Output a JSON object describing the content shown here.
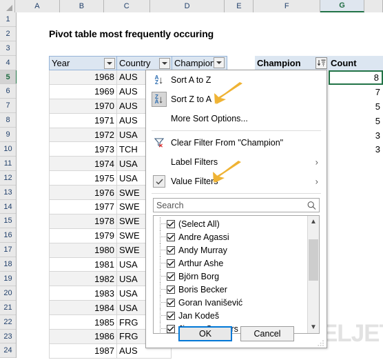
{
  "spreadsheet": {
    "columns": [
      "A",
      "B",
      "C",
      "D",
      "E",
      "F",
      "G"
    ],
    "selected_column": "G",
    "rows": [
      "1",
      "2",
      "3",
      "4",
      "5",
      "6",
      "7",
      "8",
      "9",
      "10",
      "11",
      "12",
      "13",
      "14",
      "15",
      "16",
      "17",
      "18",
      "19",
      "20",
      "21",
      "22",
      "23",
      "24"
    ],
    "selected_row": "5",
    "title": "Pivot table most frequently occuring"
  },
  "source_table": {
    "headers": [
      "Year",
      "Country",
      "Champion"
    ],
    "rows": [
      {
        "year": "1968",
        "country": "AUS"
      },
      {
        "year": "1969",
        "country": "AUS"
      },
      {
        "year": "1970",
        "country": "AUS"
      },
      {
        "year": "1971",
        "country": "AUS"
      },
      {
        "year": "1972",
        "country": "USA"
      },
      {
        "year": "1973",
        "country": "TCH"
      },
      {
        "year": "1974",
        "country": "USA"
      },
      {
        "year": "1975",
        "country": "USA"
      },
      {
        "year": "1976",
        "country": "SWE"
      },
      {
        "year": "1977",
        "country": "SWE"
      },
      {
        "year": "1978",
        "country": "SWE"
      },
      {
        "year": "1979",
        "country": "SWE"
      },
      {
        "year": "1980",
        "country": "SWE"
      },
      {
        "year": "1981",
        "country": "USA"
      },
      {
        "year": "1982",
        "country": "USA"
      },
      {
        "year": "1983",
        "country": "USA"
      },
      {
        "year": "1984",
        "country": "USA"
      },
      {
        "year": "1985",
        "country": "FRG"
      },
      {
        "year": "1986",
        "country": "FRG"
      },
      {
        "year": "1987",
        "country": "AUS"
      }
    ]
  },
  "pivot_table": {
    "headers": [
      "Champion",
      "Count"
    ],
    "counts": [
      "8",
      "7",
      "5",
      "5",
      "3",
      "3"
    ],
    "selected_cell_value": "8"
  },
  "dropdown": {
    "sort_a_to_z": "Sort A to Z",
    "sort_z_to_a": "Sort Z to A",
    "more_sort_options": "More Sort Options...",
    "clear_filter": "Clear Filter From \"Champion\"",
    "label_filters": "Label Filters",
    "value_filters": "Value Filters",
    "submenu_arrow": "›",
    "search_placeholder": "Search",
    "search_value": "",
    "list_items": [
      {
        "label": "(Select All)",
        "checked": true
      },
      {
        "label": "Andre Agassi",
        "checked": true
      },
      {
        "label": "Andy Murray",
        "checked": true
      },
      {
        "label": "Arthur Ashe",
        "checked": true
      },
      {
        "label": "Björn Borg",
        "checked": true
      },
      {
        "label": "Boris Becker",
        "checked": true
      },
      {
        "label": "Goran Ivanišević",
        "checked": true
      },
      {
        "label": "Jan Kodeš",
        "checked": true
      },
      {
        "label": "Jimmy Connors",
        "checked": true
      }
    ],
    "ok_label": "OK",
    "cancel_label": "Cancel"
  },
  "watermark": {
    "text": "EXCELJET"
  },
  "colors": {
    "excel_green": "#217346",
    "header_blue": "#dce6f1",
    "arrow_gold": "#efb334",
    "primary_blue": "#0078d7",
    "logo_peach": "#fbdfc4"
  }
}
